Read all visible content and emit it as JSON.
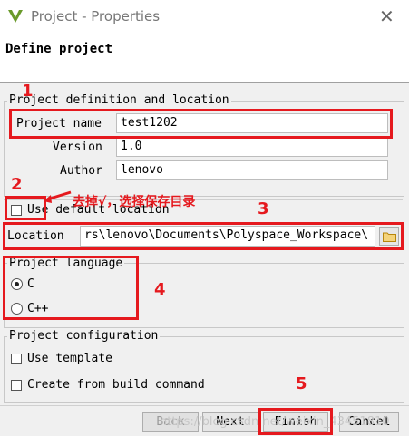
{
  "window": {
    "title": "Project - Properties",
    "close_label": "✕"
  },
  "header": {
    "title": "Define project"
  },
  "definition": {
    "legend": "Project definition and location",
    "project_name_label": "Project name",
    "project_name_value": "test1202",
    "version_label": "Version",
    "version_value": "1.0",
    "author_label": "Author",
    "author_value": "lenovo",
    "use_default_location_label": "Use default location",
    "use_default_location_checked": false,
    "location_label": "Location",
    "location_value": "rs\\lenovo\\Documents\\Polyspace_Workspace\\"
  },
  "language": {
    "legend": "Project language",
    "options": [
      {
        "label": "C",
        "selected": true
      },
      {
        "label": "C++",
        "selected": false
      }
    ]
  },
  "configuration": {
    "legend": "Project configuration",
    "use_template_label": "Use template",
    "create_from_build_label": "Create from build command"
  },
  "buttons": {
    "back": "Back",
    "next": "Next",
    "finish": "Finish",
    "cancel": "Cancel"
  },
  "annotations": {
    "n1": "1",
    "n2": "2",
    "n3": "3",
    "n4": "4",
    "n5": "5",
    "note": "去掉√，选择保存目录",
    "color": "#e5191e"
  },
  "watermark": "https://blog.csdn.net/weixin_43451810"
}
